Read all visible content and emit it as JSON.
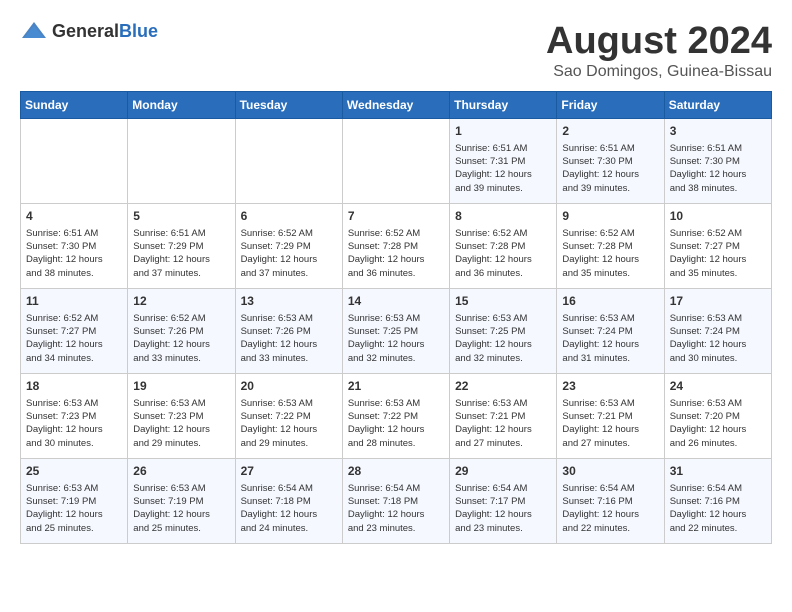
{
  "logo": {
    "general": "General",
    "blue": "Blue"
  },
  "title": "August 2024",
  "subtitle": "Sao Domingos, Guinea-Bissau",
  "days_of_week": [
    "Sunday",
    "Monday",
    "Tuesday",
    "Wednesday",
    "Thursday",
    "Friday",
    "Saturday"
  ],
  "weeks": [
    [
      {
        "day": "",
        "info": ""
      },
      {
        "day": "",
        "info": ""
      },
      {
        "day": "",
        "info": ""
      },
      {
        "day": "",
        "info": ""
      },
      {
        "day": "1",
        "info": "Sunrise: 6:51 AM\nSunset: 7:31 PM\nDaylight: 12 hours\nand 39 minutes."
      },
      {
        "day": "2",
        "info": "Sunrise: 6:51 AM\nSunset: 7:30 PM\nDaylight: 12 hours\nand 39 minutes."
      },
      {
        "day": "3",
        "info": "Sunrise: 6:51 AM\nSunset: 7:30 PM\nDaylight: 12 hours\nand 38 minutes."
      }
    ],
    [
      {
        "day": "4",
        "info": "Sunrise: 6:51 AM\nSunset: 7:30 PM\nDaylight: 12 hours\nand 38 minutes."
      },
      {
        "day": "5",
        "info": "Sunrise: 6:51 AM\nSunset: 7:29 PM\nDaylight: 12 hours\nand 37 minutes."
      },
      {
        "day": "6",
        "info": "Sunrise: 6:52 AM\nSunset: 7:29 PM\nDaylight: 12 hours\nand 37 minutes."
      },
      {
        "day": "7",
        "info": "Sunrise: 6:52 AM\nSunset: 7:28 PM\nDaylight: 12 hours\nand 36 minutes."
      },
      {
        "day": "8",
        "info": "Sunrise: 6:52 AM\nSunset: 7:28 PM\nDaylight: 12 hours\nand 36 minutes."
      },
      {
        "day": "9",
        "info": "Sunrise: 6:52 AM\nSunset: 7:28 PM\nDaylight: 12 hours\nand 35 minutes."
      },
      {
        "day": "10",
        "info": "Sunrise: 6:52 AM\nSunset: 7:27 PM\nDaylight: 12 hours\nand 35 minutes."
      }
    ],
    [
      {
        "day": "11",
        "info": "Sunrise: 6:52 AM\nSunset: 7:27 PM\nDaylight: 12 hours\nand 34 minutes."
      },
      {
        "day": "12",
        "info": "Sunrise: 6:52 AM\nSunset: 7:26 PM\nDaylight: 12 hours\nand 33 minutes."
      },
      {
        "day": "13",
        "info": "Sunrise: 6:53 AM\nSunset: 7:26 PM\nDaylight: 12 hours\nand 33 minutes."
      },
      {
        "day": "14",
        "info": "Sunrise: 6:53 AM\nSunset: 7:25 PM\nDaylight: 12 hours\nand 32 minutes."
      },
      {
        "day": "15",
        "info": "Sunrise: 6:53 AM\nSunset: 7:25 PM\nDaylight: 12 hours\nand 32 minutes."
      },
      {
        "day": "16",
        "info": "Sunrise: 6:53 AM\nSunset: 7:24 PM\nDaylight: 12 hours\nand 31 minutes."
      },
      {
        "day": "17",
        "info": "Sunrise: 6:53 AM\nSunset: 7:24 PM\nDaylight: 12 hours\nand 30 minutes."
      }
    ],
    [
      {
        "day": "18",
        "info": "Sunrise: 6:53 AM\nSunset: 7:23 PM\nDaylight: 12 hours\nand 30 minutes."
      },
      {
        "day": "19",
        "info": "Sunrise: 6:53 AM\nSunset: 7:23 PM\nDaylight: 12 hours\nand 29 minutes."
      },
      {
        "day": "20",
        "info": "Sunrise: 6:53 AM\nSunset: 7:22 PM\nDaylight: 12 hours\nand 29 minutes."
      },
      {
        "day": "21",
        "info": "Sunrise: 6:53 AM\nSunset: 7:22 PM\nDaylight: 12 hours\nand 28 minutes."
      },
      {
        "day": "22",
        "info": "Sunrise: 6:53 AM\nSunset: 7:21 PM\nDaylight: 12 hours\nand 27 minutes."
      },
      {
        "day": "23",
        "info": "Sunrise: 6:53 AM\nSunset: 7:21 PM\nDaylight: 12 hours\nand 27 minutes."
      },
      {
        "day": "24",
        "info": "Sunrise: 6:53 AM\nSunset: 7:20 PM\nDaylight: 12 hours\nand 26 minutes."
      }
    ],
    [
      {
        "day": "25",
        "info": "Sunrise: 6:53 AM\nSunset: 7:19 PM\nDaylight: 12 hours\nand 25 minutes."
      },
      {
        "day": "26",
        "info": "Sunrise: 6:53 AM\nSunset: 7:19 PM\nDaylight: 12 hours\nand 25 minutes."
      },
      {
        "day": "27",
        "info": "Sunrise: 6:54 AM\nSunset: 7:18 PM\nDaylight: 12 hours\nand 24 minutes."
      },
      {
        "day": "28",
        "info": "Sunrise: 6:54 AM\nSunset: 7:18 PM\nDaylight: 12 hours\nand 23 minutes."
      },
      {
        "day": "29",
        "info": "Sunrise: 6:54 AM\nSunset: 7:17 PM\nDaylight: 12 hours\nand 23 minutes."
      },
      {
        "day": "30",
        "info": "Sunrise: 6:54 AM\nSunset: 7:16 PM\nDaylight: 12 hours\nand 22 minutes."
      },
      {
        "day": "31",
        "info": "Sunrise: 6:54 AM\nSunset: 7:16 PM\nDaylight: 12 hours\nand 22 minutes."
      }
    ]
  ]
}
